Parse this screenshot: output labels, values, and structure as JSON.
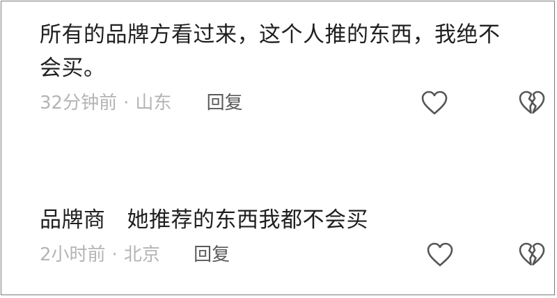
{
  "comments": [
    {
      "text": "所有的品牌方看过来，这个人推的东西，我绝不会买。",
      "time": "32分钟前",
      "separator": "·",
      "location": "山东",
      "reply_label": "回复",
      "like_icon": "heart-outline-icon",
      "dislike_icon": "broken-heart-icon"
    },
    {
      "text": "品牌商   她推荐的东西我都不会买",
      "time": "2小时前",
      "separator": "·",
      "location": "北京",
      "reply_label": "回复",
      "like_icon": "heart-outline-icon",
      "dislike_icon": "broken-heart-icon"
    }
  ],
  "colors": {
    "text": "#1f1f1f",
    "meta": "#b4b4b4",
    "reply": "#5a5a5a",
    "icon": "#555555",
    "border": "#7a7a7a"
  }
}
